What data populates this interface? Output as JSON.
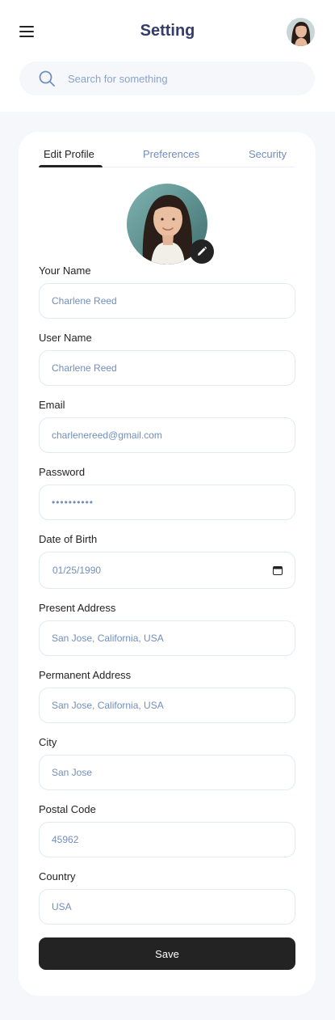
{
  "header": {
    "title": "Setting",
    "search_placeholder": "Search for something"
  },
  "tabs": [
    {
      "label": "Edit Profile",
      "active": true
    },
    {
      "label": "Preferences",
      "active": false
    },
    {
      "label": "Security",
      "active": false
    }
  ],
  "form": {
    "your_name": {
      "label": "Your Name",
      "value": "Charlene Reed"
    },
    "user_name": {
      "label": "User Name",
      "value": "Charlene Reed"
    },
    "email": {
      "label": "Email",
      "value": "charlenereed@gmail.com"
    },
    "password": {
      "label": "Password",
      "value": "••••••••••"
    },
    "dob": {
      "label": "Date of Birth",
      "value": "01/25/1990"
    },
    "present_address": {
      "label": "Present Address",
      "value": "San Jose, California, USA"
    },
    "permanent_address": {
      "label": "Permanent Address",
      "value": "San Jose, California, USA"
    },
    "city": {
      "label": "City",
      "value": "San Jose"
    },
    "postal_code": {
      "label": "Postal Code",
      "value": "45962"
    },
    "country": {
      "label": "Country",
      "value": "USA"
    }
  },
  "save_label": "Save",
  "colors": {
    "title": "#343c6a",
    "tab_inactive": "#718ebf",
    "input_text": "#718ebf",
    "input_border": "#dfeaf2",
    "dark": "#232323",
    "page_bg": "#f5f7fa"
  }
}
